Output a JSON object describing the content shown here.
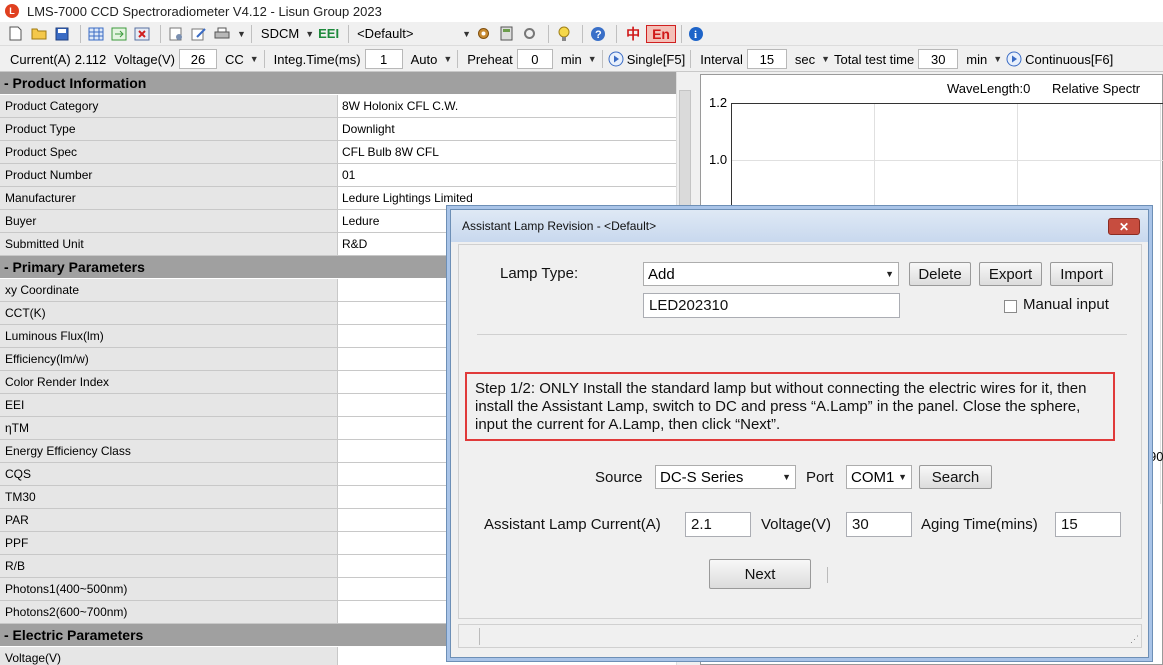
{
  "window": {
    "title": "LMS-7000 CCD Spectroradiometer V4.12 - Lisun Group 2023"
  },
  "toolbar1": {
    "icons": [
      "new-file-icon",
      "open-folder-icon",
      "save-icon",
      "table-icon",
      "export-sheet-icon",
      "delete-sheet-icon",
      "settings-sheet-icon",
      "edit-icon",
      "print-icon",
      "camera-icon",
      "refresh-icon"
    ],
    "mode_label": "SDCM",
    "eei_label": "EEI",
    "profile_value": "<Default>",
    "zh_label": "中",
    "en_label": "En"
  },
  "toolbar2": {
    "current_label": "Current(A)",
    "current_value": "2.112",
    "voltage_label": "Voltage(V)",
    "voltage_value": "26",
    "cc_label": "CC",
    "integ_label": "Integ.Time(ms)",
    "integ_value": "1",
    "auto_label": "Auto",
    "preheat_label": "Preheat",
    "preheat_value": "0",
    "min_label": "min",
    "single_label": "Single[F5]",
    "interval_label": "Interval",
    "interval_value": "15",
    "sec_label": "sec",
    "total_label": "Total test time",
    "total_value": "30",
    "min2_label": "min",
    "continuous_label": "Continuous[F6]"
  },
  "sections": {
    "product": {
      "title": "- Product Information",
      "rows": [
        {
          "k": "Product Category",
          "v": "8W Holonix CFL C.W."
        },
        {
          "k": "Product Type",
          "v": "Downlight"
        },
        {
          "k": "Product Spec",
          "v": "CFL Bulb  8W CFL"
        },
        {
          "k": "Product Number",
          "v": "01"
        },
        {
          "k": "Manufacturer",
          "v": "Ledure Lightings Limited"
        },
        {
          "k": "Buyer",
          "v": "Ledure"
        },
        {
          "k": "Submitted Unit",
          "v": "R&D"
        }
      ]
    },
    "primary": {
      "title": "- Primary Parameters",
      "rows": [
        {
          "k": "xy Coordinate",
          "v": ""
        },
        {
          "k": "CCT(K)",
          "v": ""
        },
        {
          "k": "Luminous Flux(lm)",
          "v": ""
        },
        {
          "k": "Efficiency(lm/w)",
          "v": ""
        },
        {
          "k": "Color Render Index",
          "v": ""
        },
        {
          "k": "EEI",
          "v": ""
        },
        {
          "k": "ηTM",
          "v": ""
        },
        {
          "k": "Energy Efficiency Class",
          "v": ""
        },
        {
          "k": "CQS",
          "v": ""
        },
        {
          "k": "TM30",
          "v": ""
        },
        {
          "k": "PAR",
          "v": ""
        },
        {
          "k": "PPF",
          "v": ""
        },
        {
          "k": "R/B",
          "v": ""
        },
        {
          "k": "Photons1(400~500nm)",
          "v": ""
        },
        {
          "k": "Photons2(600~700nm)",
          "v": ""
        }
      ]
    },
    "electric": {
      "title": "- Electric Parameters",
      "rows": [
        {
          "k": "Voltage(V)",
          "v": ""
        }
      ]
    }
  },
  "chart": {
    "wavelength_label": "WaveLength:0",
    "relative_label": "Relative Spectr",
    "y_ticks": [
      "1.2",
      "1.0"
    ],
    "side_label": "90"
  },
  "dialog": {
    "title": "Assistant Lamp Revision - <Default>",
    "close_label": "✕",
    "lamp_type_label": "Lamp Type:",
    "lamp_type_value": "Add",
    "delete_label": "Delete",
    "export_label": "Export",
    "import_label": "Import",
    "lamp_name_value": "LED202310",
    "manual_input_label": "Manual input",
    "note": "Step 1/2: ONLY Install the standard lamp but without connecting the electric wires for it, then install the Assistant Lamp, switch to DC and press “A.Lamp” in the panel. Close the sphere, input the current for A.Lamp, then click “Next”.",
    "source_label": "Source",
    "source_value": "DC-S Series",
    "port_label": "Port",
    "port_value": "COM1",
    "search_label": "Search",
    "al_current_label": "Assistant Lamp Current(A)",
    "al_current_value": "2.1",
    "al_voltage_label": "Voltage(V)",
    "al_voltage_value": "30",
    "aging_label": "Aging Time(mins)",
    "aging_value": "15",
    "next_label": "Next"
  }
}
